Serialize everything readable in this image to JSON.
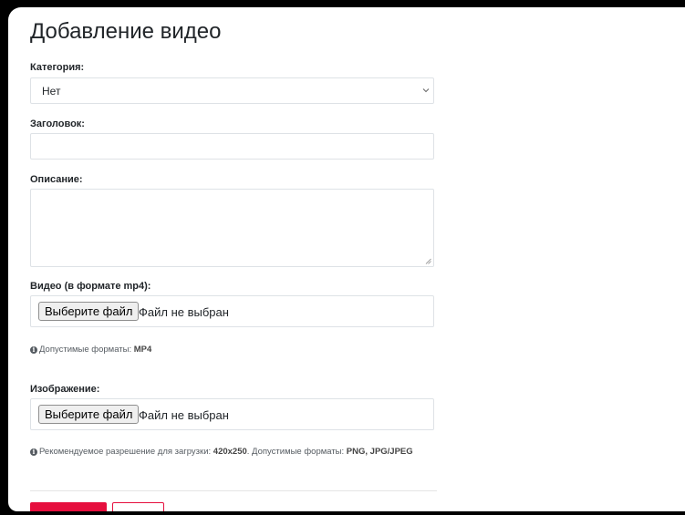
{
  "page_title": "Добавление видео",
  "category": {
    "label": "Категория:",
    "selected": "Нет"
  },
  "title_field": {
    "label": "Заголовок:",
    "value": ""
  },
  "description": {
    "label": "Описание:",
    "value": ""
  },
  "video": {
    "label": "Видео (в формате mp4):",
    "button": "Выберите файл",
    "status": "Файл не выбран",
    "hint_prefix": "Допустимые форматы: ",
    "hint_formats": "MP4"
  },
  "image": {
    "label": "Изображение:",
    "button": "Выберите файл",
    "status": "Файл не выбран",
    "hint_prefix": "Рекомендуемое разрешение для загрузки: ",
    "hint_resolution": "420x250",
    "hint_middle": ". Допустимые форматы: ",
    "hint_formats": "PNG, JPG/JPEG"
  },
  "colors": {
    "accent": "#e60f3e",
    "frame": "#000000",
    "text": "#212529"
  },
  "icons": {
    "select": "chevron-down-icon",
    "hint": "info-icon",
    "textarea": "resize-handle-icon"
  }
}
